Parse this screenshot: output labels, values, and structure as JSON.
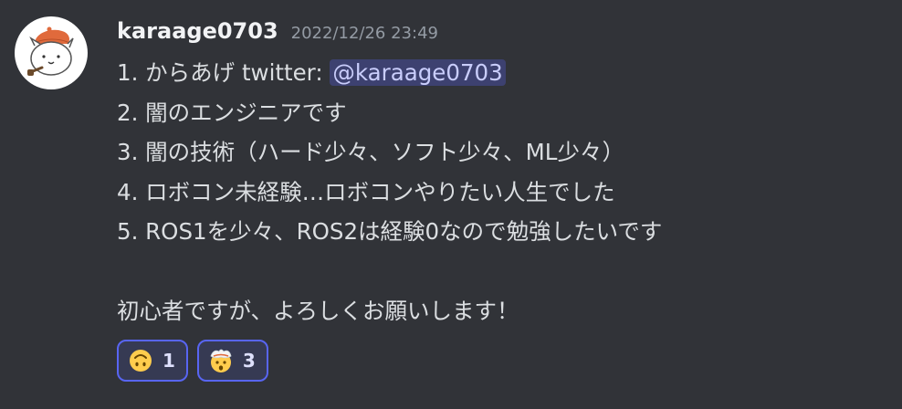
{
  "message": {
    "author": "karaage0703",
    "timestamp": "2022/12/26 23:49",
    "lines": {
      "l1_prefix": "1. からあげ twitter: ",
      "l1_mention": "@karaage0703",
      "l2": "2. 闇のエンジニアです",
      "l3": "3. 闇の技術（ハード少々、ソフト少々、ML少々）",
      "l4": "4. ロボコン未経験…ロボコンやりたい人生でした",
      "l5": "5. ROS1を少々、ROS2は経験0なので勉強したいです",
      "closing": "初心者ですが、よろしくお願いします！"
    }
  },
  "reactions": [
    {
      "emoji": "upside-down-face-emoji",
      "count": "1"
    },
    {
      "emoji": "exploding-head-emoji",
      "count": "3"
    }
  ],
  "colors": {
    "background": "#313338",
    "text": "#dbdee1",
    "username": "#f2f3f5",
    "timestamp": "#949ba4",
    "mention_bg": "#3c4270",
    "mention_text": "#c9cdfb",
    "reaction_border": "#5865f2",
    "avatar_hat": "#e06a3c"
  }
}
